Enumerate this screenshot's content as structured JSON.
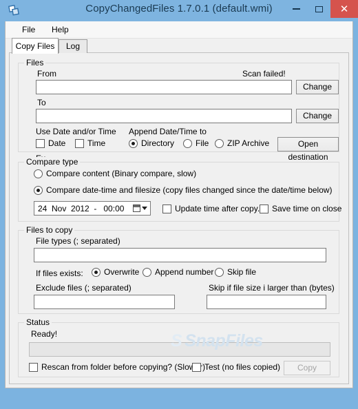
{
  "window": {
    "title": "CopyChangedFiles 1.7.0.1 (default.wmi)",
    "app_icon": "copy-files-icon",
    "minimize_label": "Minimize",
    "maximize_label": "Maximize",
    "close_label": "Close",
    "close_color": "#d5534d",
    "frame_color": "#7eb4e0"
  },
  "menubar": {
    "items": [
      {
        "label": "File"
      },
      {
        "label": "Help"
      }
    ]
  },
  "tabs": [
    {
      "label": "Copy Files",
      "active": true
    },
    {
      "label": "Log",
      "active": false
    }
  ],
  "files_group": {
    "title": "Files",
    "from_label": "From",
    "from_value": "",
    "from_placeholder": "",
    "scan_status": "Scan failed!",
    "from_change_label": "Change",
    "to_label": "To",
    "to_value": "",
    "to_placeholder": "",
    "to_change_label": "Change",
    "use_date_time_label": "Use Date and/or Time",
    "date_checkbox_label": "Date",
    "date_checked": false,
    "time_checkbox_label": "Time",
    "time_checked": false,
    "append_label": "Append Date/Time to",
    "append_options": [
      {
        "label": "Directory",
        "checked": true
      },
      {
        "label": "File",
        "checked": false
      },
      {
        "label": "ZIP Archive",
        "checked": false
      }
    ],
    "open_destination_label": "Open destination",
    "example_label": "Ex.",
    "example_value": ""
  },
  "compare_group": {
    "title": "Compare type",
    "options": [
      {
        "label": "Compare content (Binary compare, slow)",
        "checked": false
      },
      {
        "label": "Compare date-time and filesize (copy files changed since the date/time below)",
        "checked": true
      }
    ],
    "date_value": "24  Nov  2012  -   00:00",
    "update_time_label": "Update time after copy.",
    "update_time_checked": false,
    "save_time_label": "Save time on close",
    "save_time_checked": false
  },
  "copy_group": {
    "title": "Files to copy",
    "file_types_label": "File types (; separated)",
    "file_types_value": "",
    "if_exists_label": "If files exists:",
    "if_exists_options": [
      {
        "label": "Overwrite",
        "checked": true
      },
      {
        "label": "Append number",
        "checked": false
      },
      {
        "label": "Skip file",
        "checked": false
      }
    ],
    "exclude_label": "Exclude files (; separated)",
    "exclude_value": "",
    "skip_size_label": "Skip if file size i larger than (bytes)",
    "skip_size_value": ""
  },
  "status_group": {
    "title": "Status",
    "status_text": "Ready!",
    "progress_percent": 0,
    "rescan_label": "Rescan from folder before copying? (Slower)",
    "rescan_checked": false,
    "test_label": "Test (no files copied)",
    "test_checked": false,
    "copy_button_label": "Copy",
    "copy_button_enabled": false
  },
  "watermark": {
    "logo_mark": "S",
    "text": "SnapFiles"
  }
}
